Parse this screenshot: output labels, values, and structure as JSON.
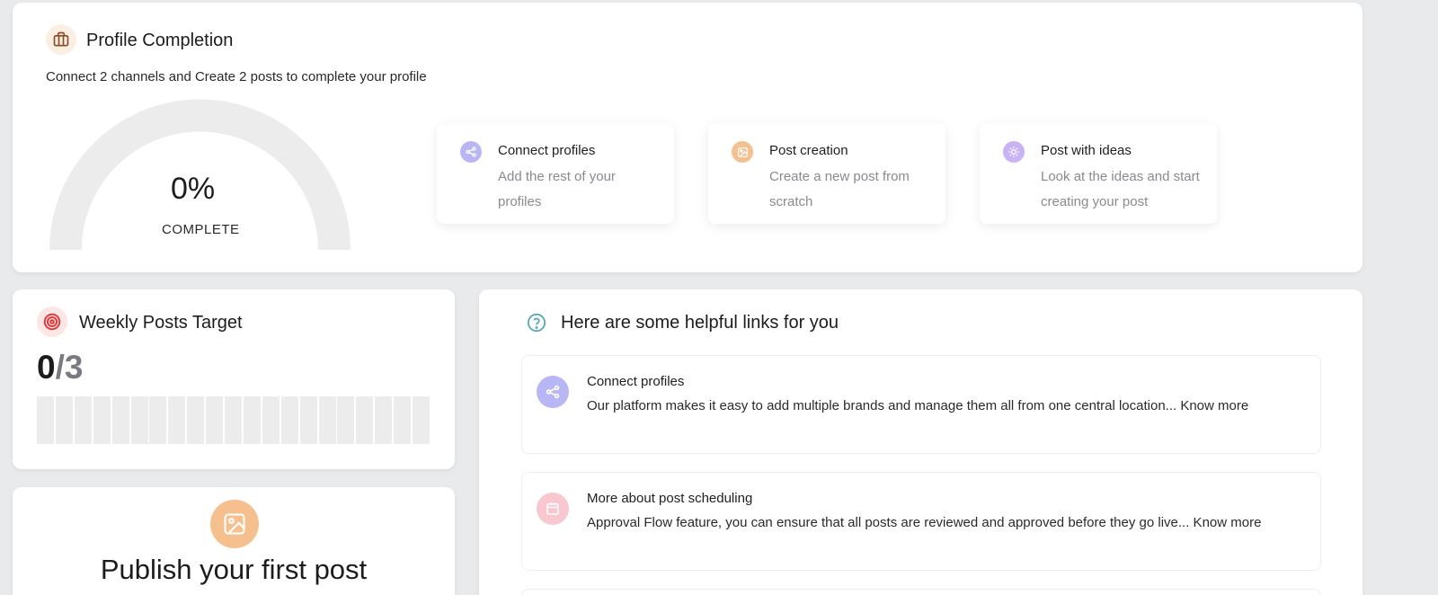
{
  "profile_completion": {
    "title": "Profile Completion",
    "subtitle": "Connect 2 channels and Create 2 posts to complete your profile",
    "percent_label": "0%",
    "complete_label": "COMPLETE",
    "progress": 0,
    "steps": [
      {
        "title": "Connect profiles",
        "description": "Add the rest of your profiles",
        "icon": "share-icon",
        "color": "#b9b6f5"
      },
      {
        "title": "Post creation",
        "description": "Create a new post from scratch",
        "icon": "image-icon",
        "color": "#f6c08e"
      },
      {
        "title": "Post with ideas",
        "description": "Look at the ideas and start creating your post",
        "icon": "lightbulb-icon",
        "color": "#c9b3f5"
      }
    ]
  },
  "weekly_target": {
    "title": "Weekly Posts Target",
    "current": "0",
    "goal": "/3",
    "segments": 21,
    "filled": 0
  },
  "publish_card": {
    "title": "Publish your first post",
    "icon": "image-icon",
    "color": "#f6c08e"
  },
  "helpful_links": {
    "title": "Here are some helpful links for you",
    "items": [
      {
        "title": "Connect profiles",
        "description": "Our platform makes it easy to add multiple brands and manage them all from one central location... Know more",
        "icon": "share-icon",
        "color": "#b9b6f5"
      },
      {
        "title": "More about post scheduling",
        "description": "Approval Flow feature, you can ensure that all posts are reviewed and approved before they go live... Know more",
        "icon": "calendar-icon",
        "color": "#f8c7cf"
      }
    ]
  },
  "colors": {
    "accent_purple": "#b9b6f5",
    "accent_orange": "#f6c08e",
    "accent_red": "#e03c3c",
    "accent_teal": "#5ba8b8"
  }
}
